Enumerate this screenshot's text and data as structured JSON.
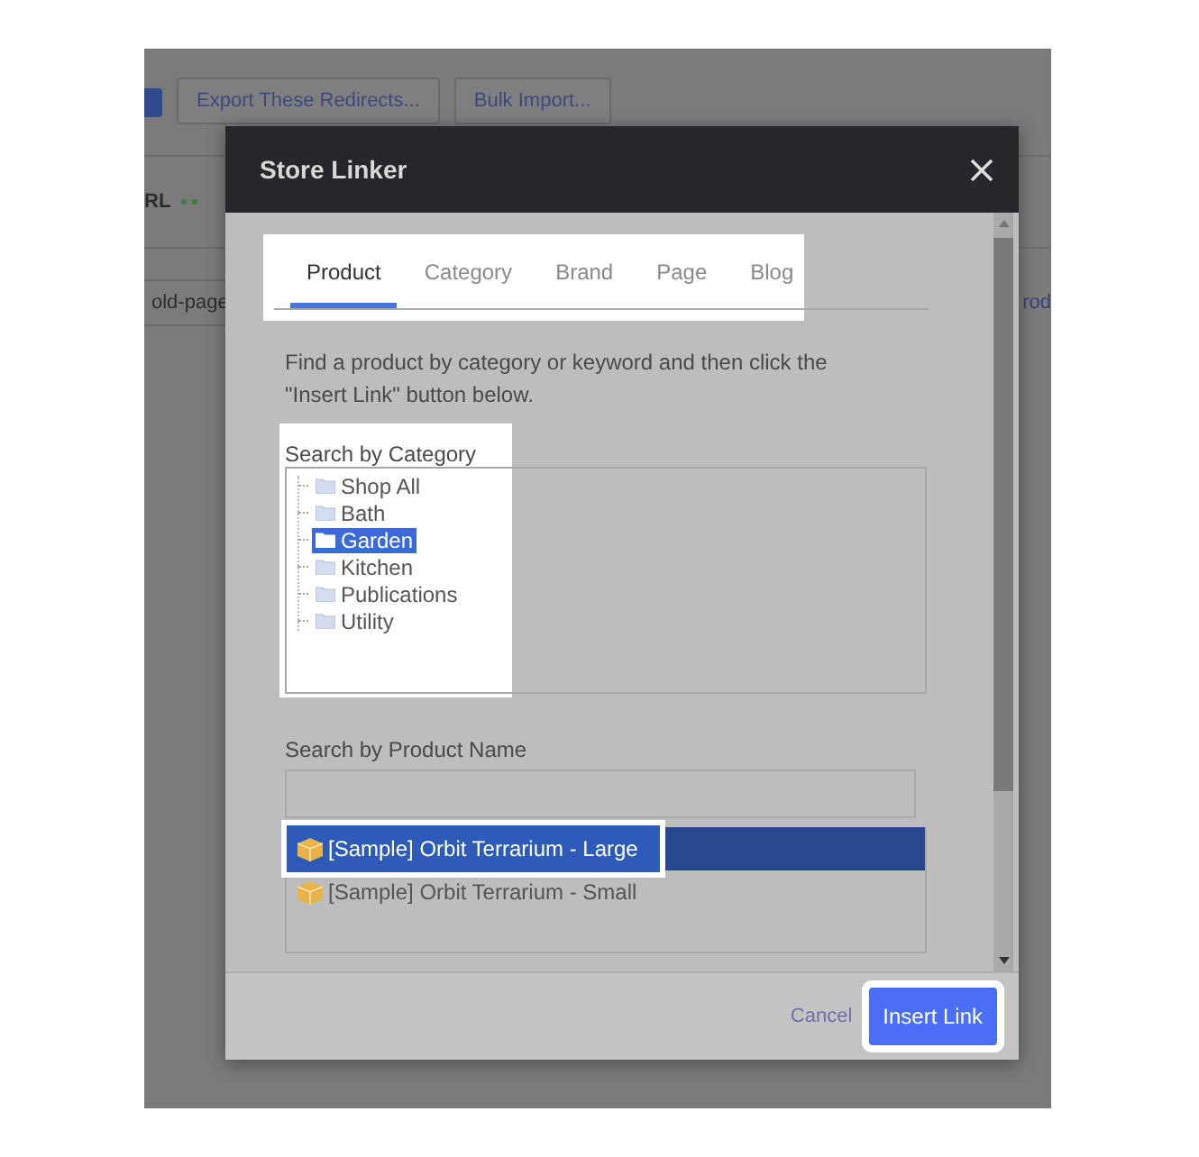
{
  "background": {
    "toolbar": [
      {
        "label": "Export These Redirects..."
      },
      {
        "label": "Bulk Import..."
      }
    ],
    "column_header": "RL",
    "cells": [
      "old-page",
      "rod"
    ]
  },
  "dialog": {
    "title": "Store Linker",
    "tabs": [
      {
        "label": "Product",
        "selected": true
      },
      {
        "label": "Category",
        "selected": false
      },
      {
        "label": "Brand",
        "selected": false
      },
      {
        "label": "Page",
        "selected": false
      },
      {
        "label": "Blog",
        "selected": false
      }
    ],
    "instructions": "Find a product by category or keyword and then click the \"Insert Link\" button below.",
    "category_label": "Search by Category",
    "categories": [
      {
        "label": "Shop All",
        "selected": false
      },
      {
        "label": "Bath",
        "selected": false
      },
      {
        "label": "Garden",
        "selected": true
      },
      {
        "label": "Kitchen",
        "selected": false
      },
      {
        "label": "Publications",
        "selected": false
      },
      {
        "label": "Utility",
        "selected": false
      }
    ],
    "product_label": "Search by Product Name",
    "products": [
      {
        "label": "[Sample] Orbit Terrarium - Large",
        "selected": true
      },
      {
        "label": "[Sample] Orbit Terrarium - Small",
        "selected": false
      }
    ],
    "cancel": "Cancel",
    "insert": "Insert Link"
  }
}
